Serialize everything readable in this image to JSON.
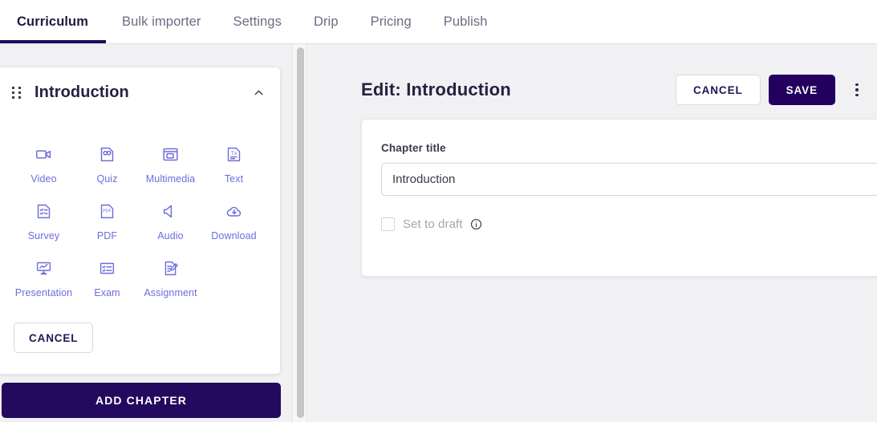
{
  "tabs": [
    {
      "label": "Curriculum",
      "active": true
    },
    {
      "label": "Bulk importer",
      "active": false
    },
    {
      "label": "Settings",
      "active": false
    },
    {
      "label": "Drip",
      "active": false
    },
    {
      "label": "Pricing",
      "active": false
    },
    {
      "label": "Publish",
      "active": false
    }
  ],
  "left_panel": {
    "chapter": {
      "title": "Introduction",
      "drag_handle_icon": "drag-dots-icon",
      "collapse_icon": "chevron-up-icon"
    },
    "content_types": [
      {
        "label": "Video",
        "icon": "video-camera-icon"
      },
      {
        "label": "Quiz",
        "icon": "quiz-document-icon"
      },
      {
        "label": "Multimedia",
        "icon": "multimedia-window-icon"
      },
      {
        "label": "Text",
        "icon": "text-document-icon"
      },
      {
        "label": "Survey",
        "icon": "survey-checklist-icon"
      },
      {
        "label": "PDF",
        "icon": "pdf-document-icon"
      },
      {
        "label": "Audio",
        "icon": "audio-speaker-icon"
      },
      {
        "label": "Download",
        "icon": "cloud-download-icon"
      },
      {
        "label": "Presentation",
        "icon": "presentation-screen-icon"
      },
      {
        "label": "Exam",
        "icon": "exam-board-icon"
      },
      {
        "label": "Assignment",
        "icon": "assignment-pencil-icon"
      }
    ],
    "cancel_label": "CANCEL",
    "add_chapter_label": "ADD CHAPTER"
  },
  "right_panel": {
    "title": "Edit: Introduction",
    "cancel_label": "CANCEL",
    "save_label": "SAVE",
    "kebab_icon": "more-vertical-icon",
    "form": {
      "field_label": "Chapter title",
      "field_value": "Introduction",
      "field_placeholder": "Chapter title",
      "draft_label": "Set to draft",
      "draft_checked": false,
      "info_icon": "info-circle-icon"
    }
  },
  "colors": {
    "accent_dark": "#24005e",
    "accent_light": "#6d6ddb",
    "page_bg": "#f1f1f3",
    "text_dark": "#242241",
    "text_muted": "#6b6b84"
  }
}
